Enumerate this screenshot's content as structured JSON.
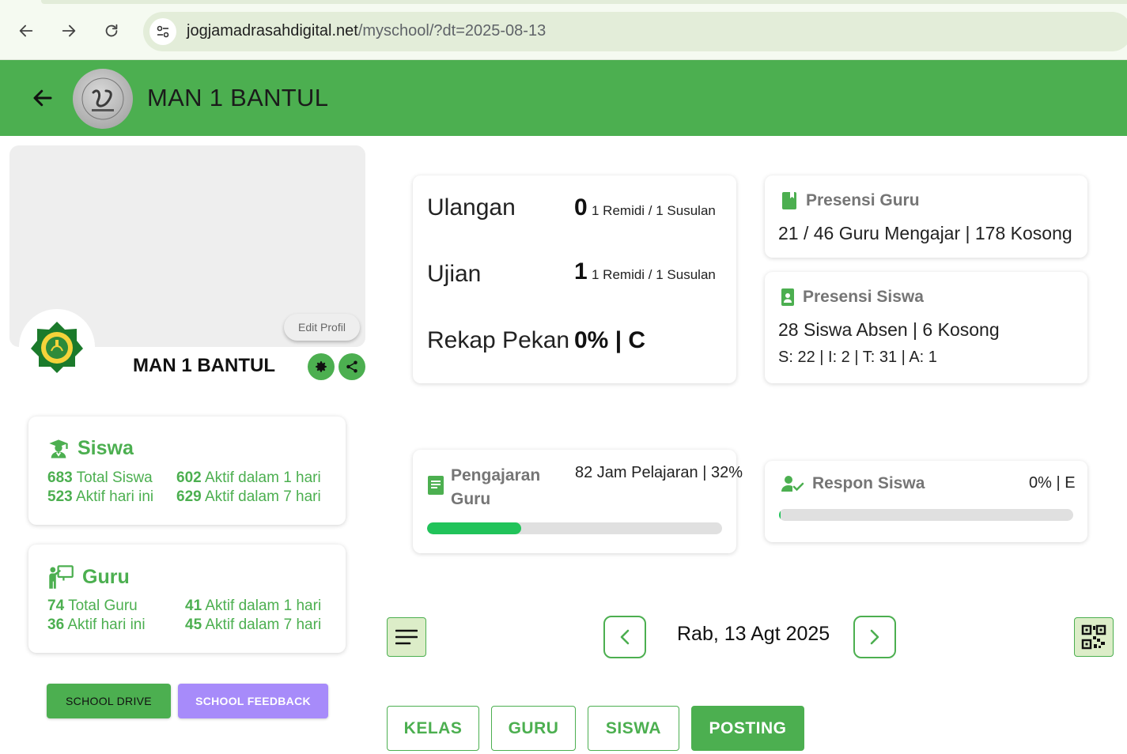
{
  "browser": {
    "url_host": "jogjamadrasahdigital.net",
    "url_path": "/myschool/?dt=2025-08-13"
  },
  "header": {
    "title": "MAN 1 BANTUL"
  },
  "profile": {
    "edit_label": "Edit Profil",
    "name": "MAN 1 BANTUL"
  },
  "siswa_card": {
    "title": "Siswa",
    "total_num": "683",
    "total_label": "Total Siswa",
    "today_num": "523",
    "today_label": "Aktif hari ini",
    "day1_num": "602",
    "day1_label": "Aktif dalam 1 hari",
    "day7_num": "629",
    "day7_label": "Aktif dalam 7 hari"
  },
  "guru_card": {
    "title": "Guru",
    "total_num": "74",
    "total_label": "Total Guru",
    "today_num": "36",
    "today_label": "Aktif hari ini",
    "day1_num": "41",
    "day1_label": "Aktif dalam 1 hari",
    "day7_num": "45",
    "day7_label": "Aktif dalam 7 hari"
  },
  "buttons": {
    "drive": "SCHOOL DRIVE",
    "feedback": "SCHOOL FEEDBACK"
  },
  "ulangan_card": {
    "ulangan_label": "Ulangan",
    "ulangan_num": "0",
    "ulangan_sub": "1 Remidi / 1 Susulan",
    "ujian_label": "Ujian",
    "ujian_num": "1",
    "ujian_sub": "1 Remidi / 1 Susulan",
    "rekap_label": "Rekap Pekan",
    "rekap_value": "0% | C"
  },
  "presensi_guru": {
    "title": "Presensi Guru",
    "text": "21 / 46 Guru Mengajar | 178 Kosong"
  },
  "presensi_siswa": {
    "title": "Presensi Siswa",
    "text": "28 Siswa Absen | 6 Kosong",
    "detail": "S: 22 | I: 2 | T: 31 | A: 1"
  },
  "pengajaran": {
    "title_line1": "Pengajaran",
    "title_line2": "Guru",
    "value": "82 Jam Pelajaran | 32%",
    "progress": 0.32
  },
  "respon": {
    "title": "Respon Siswa",
    "value": "0% | E",
    "progress": 0
  },
  "date_nav": {
    "date": "Rab, 13 Agt 2025"
  },
  "tabs": [
    {
      "label": "KELAS",
      "active": false
    },
    {
      "label": "GURU",
      "active": false
    },
    {
      "label": "SISWA",
      "active": false
    },
    {
      "label": "POSTING",
      "active": true
    }
  ],
  "colors": {
    "brand_green": "#4caf50",
    "progress_green": "#21c35a",
    "feedback_purple": "#a78bfa"
  }
}
